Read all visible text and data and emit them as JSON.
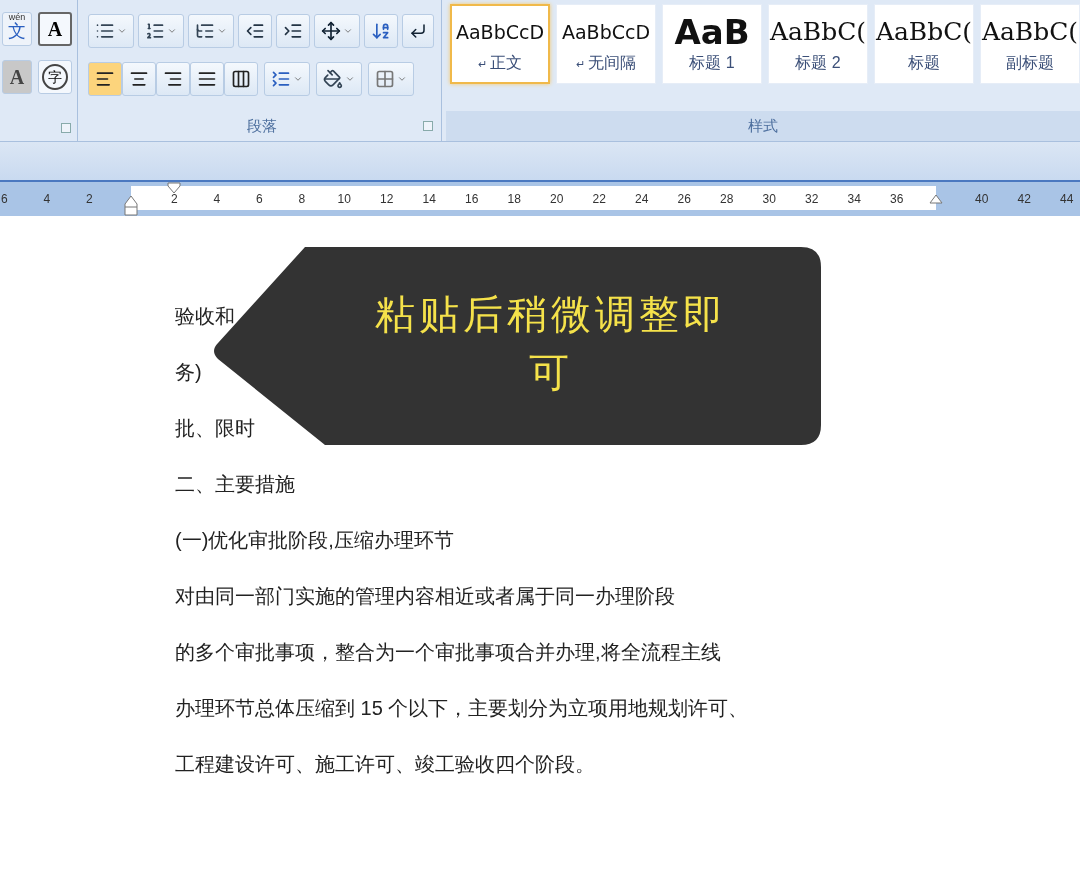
{
  "font_group": {
    "phonetic_top": "wén",
    "phonetic_glyph": "文",
    "boxed_letter": "A",
    "shaded_letter": "A",
    "enclosed_char": "字"
  },
  "paragraph_group": {
    "label": "段落",
    "alignment": [
      {
        "selected": true
      },
      {
        "selected": false
      },
      {
        "selected": false
      },
      {
        "selected": false
      },
      {
        "selected": false
      }
    ]
  },
  "styles_group": {
    "label": "样式",
    "styles": [
      {
        "preview": "AaBbCcD",
        "mark": "↵",
        "name": "正文",
        "kind": "normal",
        "selected": true
      },
      {
        "preview": "AaBbCcD",
        "mark": "↵",
        "name": "无间隔",
        "kind": "normal",
        "selected": false
      },
      {
        "preview": "AaB",
        "name": "标题 1",
        "kind": "heading1",
        "selected": false
      },
      {
        "preview": "AaBbC(",
        "name": "标题 2",
        "kind": "serif",
        "selected": false
      },
      {
        "preview": "AaBbC(",
        "name": "标题",
        "kind": "serif",
        "selected": false
      },
      {
        "preview": "AaBbC(",
        "name": "副标题",
        "kind": "serif",
        "selected": false
      }
    ]
  },
  "ruler": {
    "left_numbers": [
      "6",
      "4",
      "2"
    ],
    "numbers": [
      "2",
      "4",
      "6",
      "8",
      "10",
      "12",
      "14",
      "16",
      "18",
      "20",
      "22",
      "24",
      "26",
      "28",
      "30",
      "32",
      "34",
      "36"
    ],
    "right_numbers": [
      "40",
      "42",
      "44"
    ]
  },
  "document": {
    "partial_lines": [
      "验收和",
      "务)",
      "批、限时"
    ],
    "paragraphs": [
      "二、主要措施",
      "(一)优化审批阶段,压缩办理环节",
      "对由同一部门实施的管理内容相近或者属于同一办理阶段",
      "的多个审批事项，整合为一个审批事项合并办理,将全流程主线",
      "办理环节总体压缩到 15 个以下，主要划分为立项用地规划许可、",
      "工程建设许可、施工许可、竣工验收四个阶段。"
    ]
  },
  "callout": {
    "lines": [
      "粘贴后稍微调整即",
      "可"
    ]
  }
}
